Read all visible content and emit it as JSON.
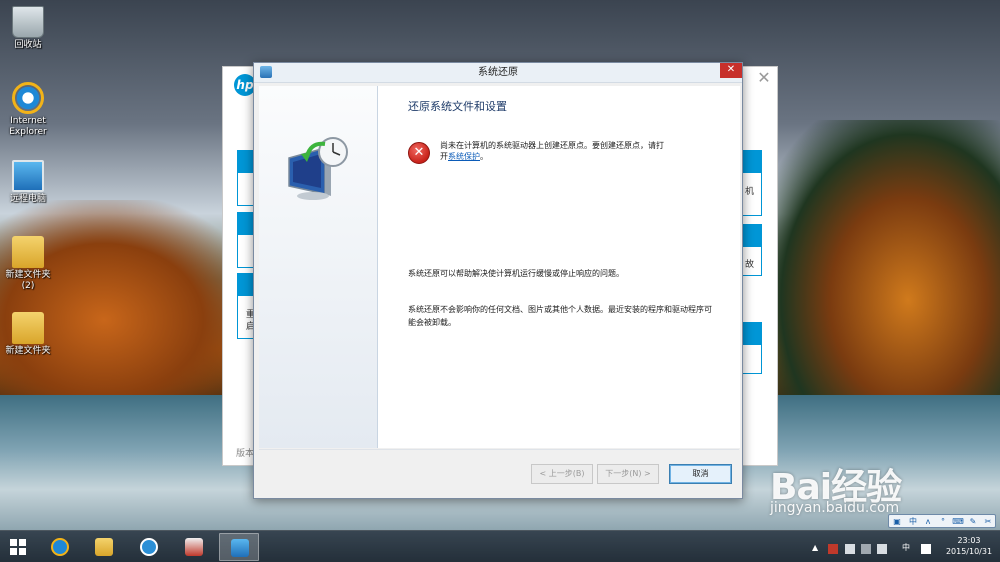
{
  "desktop": {
    "icons": [
      {
        "label": "回收站"
      },
      {
        "label": "Internet Explorer"
      },
      {
        "label": "远程电脑"
      },
      {
        "label": "新建文件夹 (2)"
      },
      {
        "label": "新建文件夹"
      }
    ]
  },
  "hp_window": {
    "logo": "hp",
    "close_glyph": "✕",
    "left_texts": [
      "重",
      "启"
    ],
    "right_texts": [
      "机",
      "故"
    ],
    "footer": "版本"
  },
  "dialog": {
    "title": "系统还原",
    "close_glyph": "✕",
    "heading": "还原系统文件和设置",
    "error_text": "尚未在计算机的系统驱动器上创建还原点。要创建还原点，请打开",
    "error_link": "系统保护",
    "error_tail": "。",
    "paragraph1": "系统还原可以帮助解决使计算机运行缓慢或停止响应的问题。",
    "paragraph2": "系统还原不会影响你的任何文档、图片或其他个人数据。最近安装的程序和驱动程序可能会被卸载。",
    "buttons": {
      "back": "< 上一步(B)",
      "next": "下一步(N) >",
      "cancel": "取消"
    }
  },
  "ime_toolbar": [
    "中",
    "ʌ",
    "°",
    "⌨",
    "✎",
    "✂"
  ],
  "tray": {
    "ime_lang": "中",
    "clock_time": "23:03",
    "clock_date": "2015/10/31"
  },
  "watermark": {
    "brand": "Bai经验",
    "url": "jingyan.baidu.com"
  },
  "colors": {
    "hp_blue": "#0096d6",
    "close_red": "#c7302b",
    "link_blue": "#0b5bb8"
  }
}
